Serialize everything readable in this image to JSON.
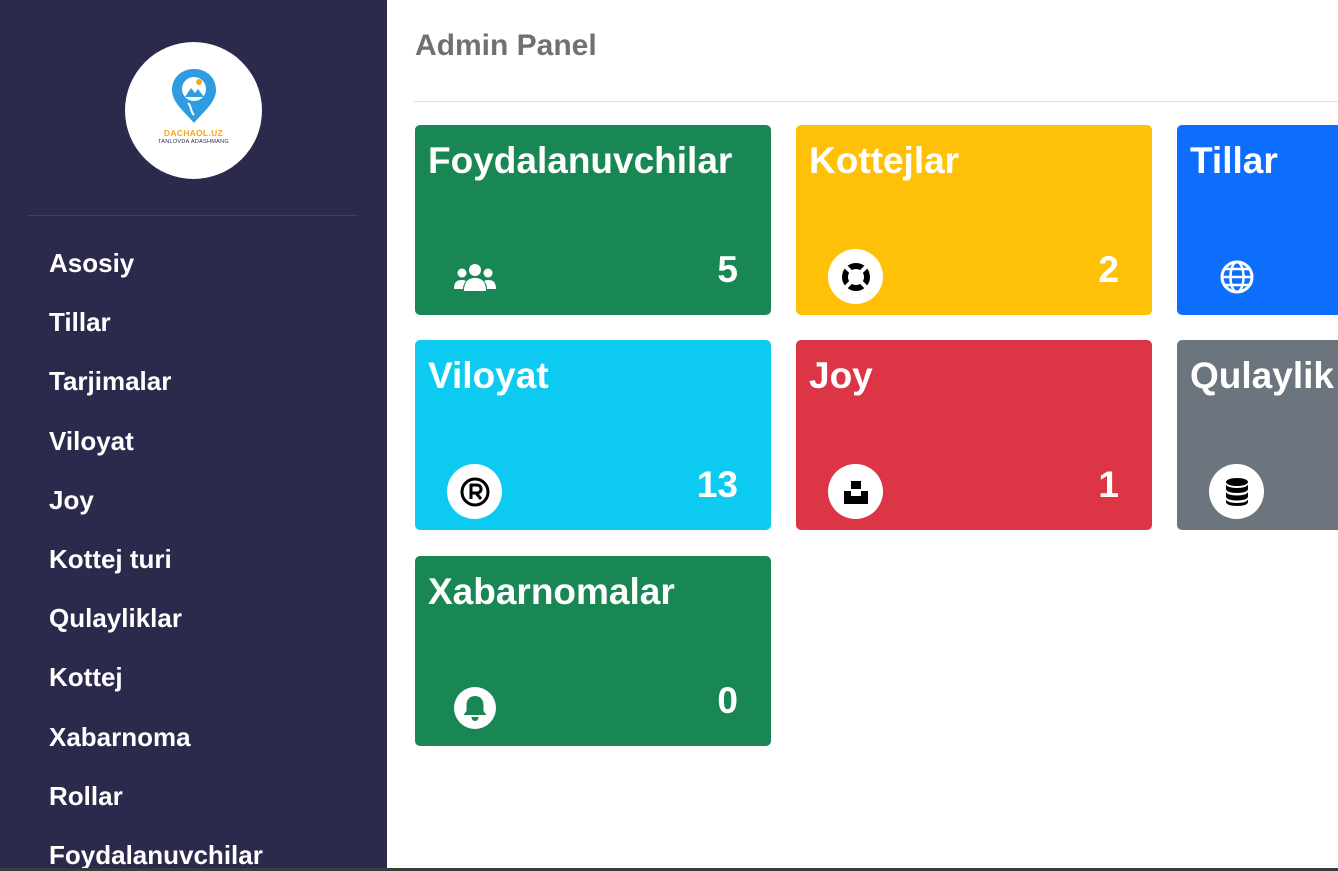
{
  "sidebar": {
    "logo": {
      "brand": "DACHAOL.UZ",
      "tagline": "TANLOVDA ADASHMANG"
    },
    "items": [
      {
        "label": "Asosiy"
      },
      {
        "label": "Tillar"
      },
      {
        "label": "Tarjimalar"
      },
      {
        "label": "Viloyat"
      },
      {
        "label": "Joy"
      },
      {
        "label": "Kottej turi"
      },
      {
        "label": "Qulayliklar"
      },
      {
        "label": "Kottej"
      },
      {
        "label": "Xabarnoma"
      },
      {
        "label": "Rollar"
      },
      {
        "label": "Foydalanuvchilar"
      }
    ]
  },
  "header": {
    "title": "Admin Panel"
  },
  "cards": [
    {
      "title": "Foydalanuvchilar",
      "count": "5",
      "icon": "users-icon",
      "color": "#198754"
    },
    {
      "title": "Kottejlar",
      "count": "2",
      "icon": "life-ring-icon",
      "color": "#ffc107"
    },
    {
      "title": "Tillar",
      "count": "",
      "icon": "globe-icon",
      "color": "#0d6efd"
    },
    {
      "title": "Viloyat",
      "count": "13",
      "icon": "registered-icon",
      "color": "#0dcaf0"
    },
    {
      "title": "Joy",
      "count": "1",
      "icon": "unsplash-icon",
      "color": "#dc3545"
    },
    {
      "title": "Qulaylik",
      "count": "",
      "icon": "database-icon",
      "color": "#6c757d"
    },
    {
      "title": "Xabarnomalar",
      "count": "0",
      "icon": "bell-icon",
      "color": "#198754"
    }
  ],
  "colors": {
    "sidebar_bg": "#2b2a4c",
    "logo_accent": "#f0a91b",
    "logo_pin": "#2f9be0",
    "title_gray": "#707070"
  }
}
